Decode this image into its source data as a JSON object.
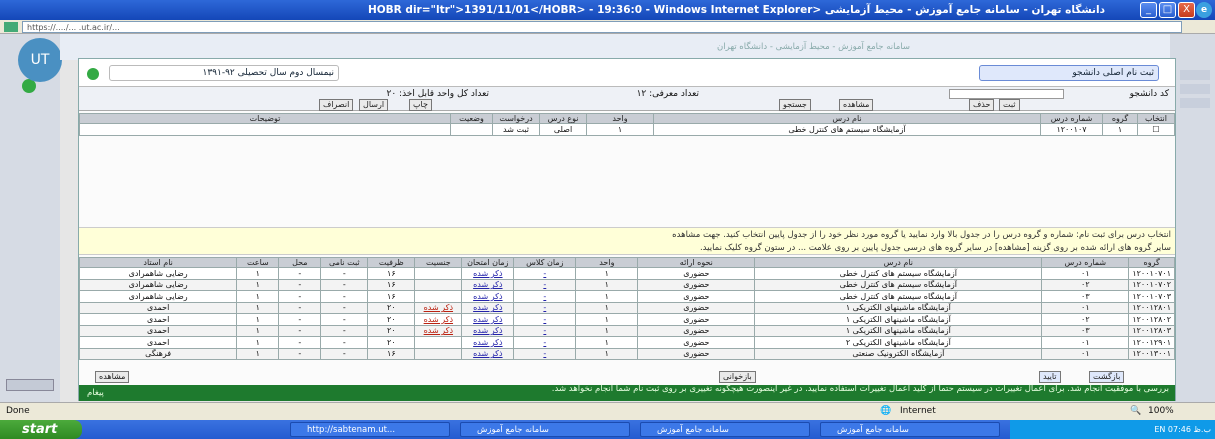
{
  "window": {
    "title": "دانشگاه تهران - سامانه جامع آموزش - محیط آزمایشی <HOBR dir=\"ltr\">1391/11/01</HOBR> - 19:36:0 - Windows Internet Explorer",
    "buttons": [
      "_",
      "□",
      "X"
    ]
  },
  "address": {
    "url": "https://..../... .ut.ac.ir/..."
  },
  "site": {
    "header": "سامانه جامع آموزش - محیط آزمایشی - دانشگاه تهران"
  },
  "dialog": {
    "title": "ثبت نام اصلی دانشجو",
    "semester": "نیمسال دوم سال تحصیلی ۹۲-۱۳۹۱",
    "info_mid": "تعداد معرفی: ۱۲",
    "info_left": "تعداد کل واحد قابل اخذ: ۲۰",
    "right_label": "کد دانشجو",
    "buttons": {
      "save": "ثبت",
      "delete": "حذف",
      "search": "جستجو",
      "print": "چاپ",
      "view": "مشاهده",
      "send": "ارسال",
      "cancel": "انصراف",
      "refresh": "بازخوانی",
      "return": "بازگشت",
      "confirm": "تایید",
      "message": "پیغام"
    },
    "table1": {
      "headers": [
        "انتخاب",
        "گروه",
        "شماره درس",
        "نام درس",
        "واحد",
        "نوع درس",
        "درخواست",
        "وضعیت",
        "توضیحات"
      ],
      "rows": [
        [
          "☐",
          "۱",
          "۱۲۰۰۱۰۷",
          "آزمایشگاه سیستم های کنترل خطی",
          "۱",
          "اصلی",
          "ثبت شد",
          "",
          ""
        ]
      ]
    },
    "notice": [
      "انتخاب درس برای ثبت نام: شماره و گروه درس را در جدول بالا وارد نمایید یا گروه مورد نظر خود را از جدول پایین انتخاب کنید. جهت مشاهده",
      "سایر گروه های ارائه شده بر روی گزینه [مشاهده] در سایر گروه های درسی جدول پایین بر روی علامت ... در ستون گروه کلیک نمایید."
    ],
    "table2": {
      "headers": [
        "گروه",
        "شماره درس",
        "نام درس",
        "نحوه ارائه",
        "واحد",
        "زمان کلاس",
        "زمان امتحان",
        "جنسیت",
        "ظرفیت",
        "ثبت نامی",
        "محل",
        "ساعت",
        "نام استاد"
      ],
      "rows": [
        [
          "۱۲۰۰۱۰۷۰۱",
          "۰۱",
          "آزمایشگاه سیستم های کنترل خطی",
          "حضوری",
          "۱",
          "-",
          "ذکر شده",
          "",
          "۱۶",
          "-",
          "-",
          "۱",
          "رضایی شاهمرادی"
        ],
        [
          "۱۲۰۰۱۰۷۰۲",
          "۰۲",
          "آزمایشگاه سیستم های کنترل خطی",
          "حضوری",
          "۱",
          "-",
          "ذکر شده",
          "",
          "۱۶",
          "-",
          "-",
          "۱",
          "رضایی شاهمرادی"
        ],
        [
          "۱۲۰۰۱۰۷۰۳",
          "۰۳",
          "آزمایشگاه سیستم های کنترل خطی",
          "حضوری",
          "۱",
          "-",
          "ذکر شده",
          "",
          "۱۶",
          "-",
          "-",
          "۱",
          "رضایی شاهمرادی"
        ],
        [
          "۱۲۰۰۱۲۸۰۱",
          "۰۱",
          "آزمایشگاه ماشینهای الکتریکی ۱",
          "حضوری",
          "۱",
          "-",
          "ذکر شده",
          "ذکر شده",
          "۲۰",
          "-",
          "-",
          "۱",
          "احمدی"
        ],
        [
          "۱۲۰۰۱۲۸۰۲",
          "۰۲",
          "آزمایشگاه ماشینهای الکتریکی ۱",
          "حضوری",
          "۱",
          "-",
          "ذکر شده",
          "ذکر شده",
          "۲۰",
          "-",
          "-",
          "۱",
          "احمدی"
        ],
        [
          "۱۲۰۰۱۲۸۰۳",
          "۰۳",
          "آزمایشگاه ماشینهای الکتریکی ۱",
          "حضوری",
          "۱",
          "-",
          "ذکر شده",
          "ذکر شده",
          "۲۰",
          "-",
          "-",
          "۱",
          "احمدی"
        ],
        [
          "۱۲۰۰۱۲۹۰۱",
          "۰۱",
          "آزمایشگاه ماشینهای الکتریکی ۲",
          "حضوری",
          "۱",
          "-",
          "ذکر شده",
          "",
          "۲۰",
          "-",
          "-",
          "۱",
          "احمدی"
        ],
        [
          "۱۲۰۰۱۳۰۰۱",
          "۰۱",
          "آزمایشگاه الکترونیک صنعتی",
          "حضوری",
          "۱",
          "-",
          "ذکر شده",
          "",
          "۱۶",
          "-",
          "-",
          "۱",
          "فرهنگی"
        ]
      ]
    },
    "green_bar": "بررسی با موفقیت انجام شد. برای اعمال تغییرات در سیستم حتما از کلید اعمال تغییرات استفاده نمایید. در غیر اینصورت هیچگونه تغییری بر روی ثبت نام شما انجام نخواهد شد."
  },
  "statusbar": {
    "left": "Done",
    "zone": "Internet",
    "zoom": "100%"
  },
  "taskbar": {
    "start": "start",
    "tasks": [
      "http://sabtenam.ut...",
      "سامانه جامع آموزش",
      "سامانه جامع آموزش",
      "سامانه جامع آموزش"
    ],
    "tray": "EN  07:46 ب.ظ"
  },
  "colors": {
    "titlebar": "#1447b8",
    "green_bar": "#1e7a2e",
    "notice": "#ffffd8"
  }
}
